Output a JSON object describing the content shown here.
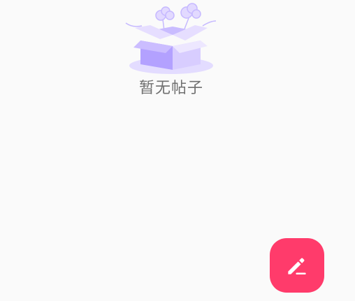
{
  "empty_state": {
    "message": "暂无帖子",
    "illustration_icon": "open-box-icon"
  },
  "fab": {
    "icon": "edit-pen-icon",
    "color": "#ff3b6b"
  },
  "colors": {
    "background": "#fafafa",
    "box_light": "#dcd4ff",
    "box_dark": "#b6a6ff",
    "text": "#707070"
  }
}
